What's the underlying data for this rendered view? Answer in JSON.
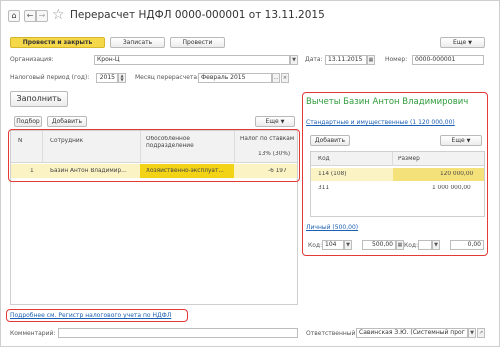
{
  "titlebar": {
    "title": "Перерасчет НДФЛ 0000-000001 от 13.11.2015"
  },
  "toolbar": {
    "post_close": "Провести и закрыть",
    "save": "Записать",
    "post": "Провести",
    "more": "Еще"
  },
  "header": {
    "org_label": "Организация:",
    "org_value": "Крон-Ц",
    "date_label": "Дата:",
    "date_value": "13.11.2015",
    "number_label": "Номер:",
    "number_value": "0000-000001",
    "period_label": "Налоговый период (год):",
    "period_value": "2015",
    "month_label": "Месяц перерасчета:",
    "month_value": "Февраль 2015"
  },
  "fill_button": "Заполнить",
  "left_toolbar": {
    "select": "Подбор",
    "add": "Добавить",
    "more": "Еще"
  },
  "table": {
    "columns": [
      "N",
      "Сотрудник",
      "Обособленное подразделение",
      "Налог по ставкам"
    ],
    "subheader": "13% (30%)",
    "rows": [
      {
        "n": "1",
        "employee": "Базин Антон Владимир...",
        "division": "Хозяйственно-эксплуат...",
        "tax": "-6 197"
      }
    ]
  },
  "right_panel": {
    "title": "Вычеты Базин Антон Владимирович",
    "std_link": "Стандартные и имущественные (1 120 000,00)",
    "add": "Добавить",
    "more": "Еще",
    "columns": [
      "Код",
      "Размер"
    ],
    "rows": [
      {
        "code": "114 (108)",
        "amount": "120 000,00"
      },
      {
        "code": "311",
        "amount": "1 000 000,00"
      }
    ],
    "personal_link": "Личный (500,00)",
    "code_label": "Код:",
    "code_value": "104",
    "amount_value": "500,00",
    "code2_label": "Код:",
    "amount2_value": "0,00"
  },
  "footer": {
    "register_link": "Подробнее см. Регистр налогового учета по НДФЛ",
    "comment_label": "Комментарий:",
    "responsible_label": "Ответственный:",
    "responsible_value": "Савинская З.Ю. (Системный прог"
  }
}
